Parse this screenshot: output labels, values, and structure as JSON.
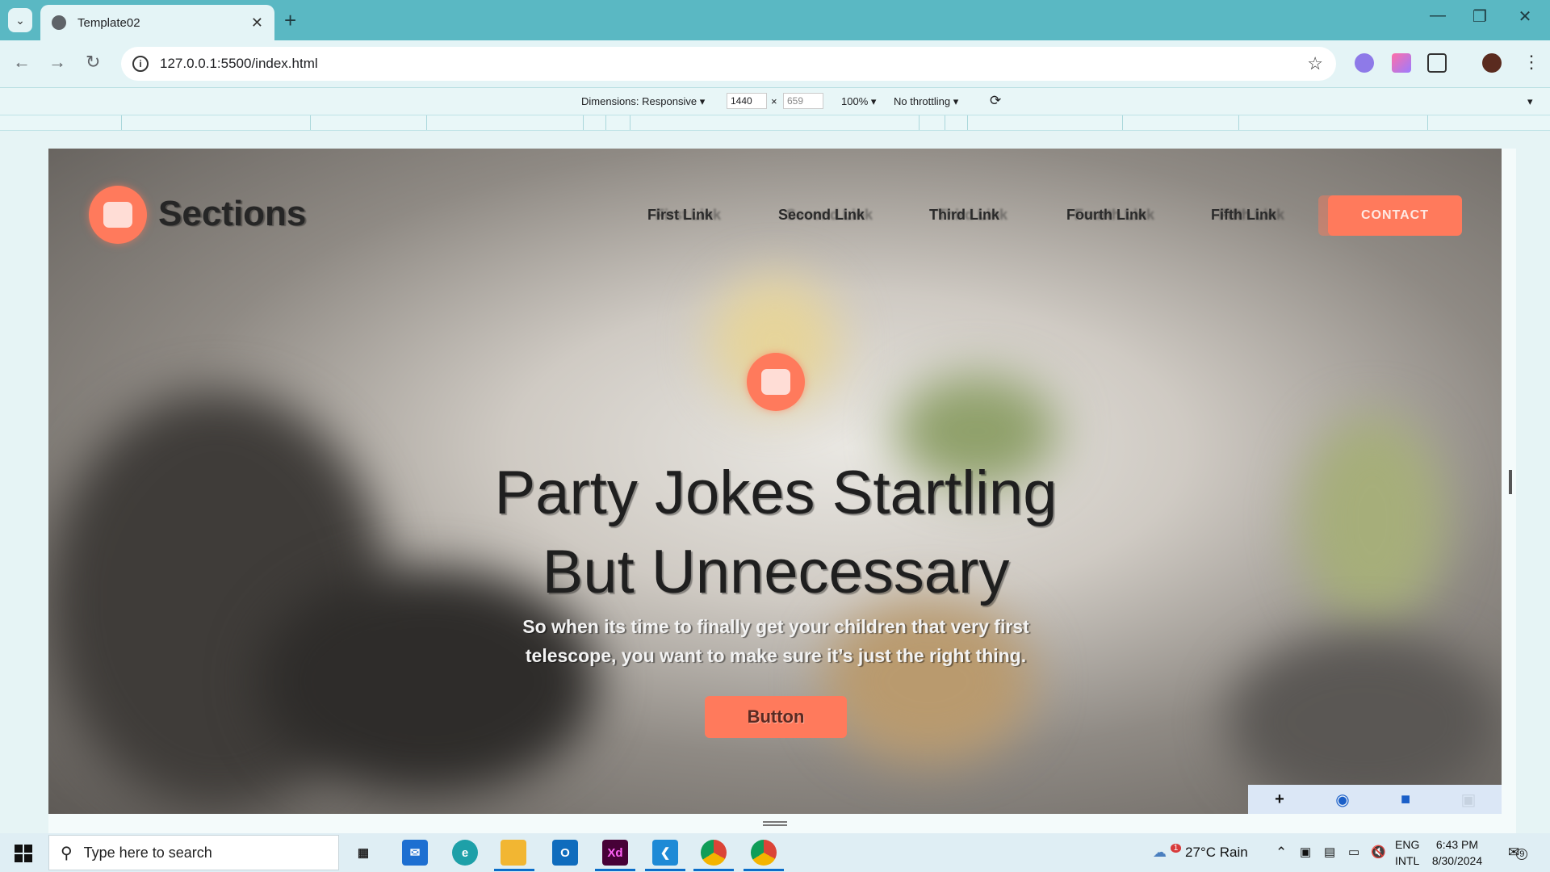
{
  "browser": {
    "tab_title": "Template02",
    "url": "127.0.0.1:5500/index.html"
  },
  "devtools": {
    "dimensions_label": "Dimensions: Responsive",
    "width": "1440",
    "height": "659",
    "zoom": "100%",
    "throttling": "No throttling"
  },
  "site": {
    "brand": "Sections",
    "nav_links": [
      "First Link",
      "Second Link",
      "Third Link",
      "Fourth Link",
      "Fifth Link"
    ],
    "contact_label": "CONTACT",
    "hero_title_line1": "Party Jokes Startling",
    "hero_title_line2": "But Unnecessary",
    "hero_subtitle_line1": "So when its time to finally get your children that very first",
    "hero_subtitle_line2": "telescope, you want to make sure it’s just the right thing.",
    "hero_button": "Button",
    "accent_color": "#ff7a5c"
  },
  "taskbar": {
    "search_placeholder": "Type here to search",
    "weather": "27°C  Rain",
    "weather_badge": "1",
    "language_line1": "ENG",
    "language_line2": "INTL",
    "time": "6:43 PM",
    "date": "8/30/2024",
    "notification_count": "9",
    "apps": [
      "task-view",
      "mail",
      "edge",
      "file-explorer",
      "outlook",
      "adobe-xd",
      "vscode",
      "chrome",
      "chrome"
    ]
  }
}
